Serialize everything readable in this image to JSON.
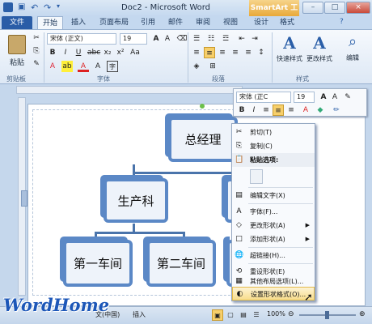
{
  "window": {
    "title": "Doc2 - Microsoft Word",
    "context_tab": "SmartArt 工具",
    "buttons": [
      "–",
      "□",
      "×"
    ]
  },
  "tabs": [
    "文件",
    "开始",
    "插入",
    "页面布局",
    "引用",
    "邮件",
    "审阅",
    "视图",
    "设计",
    "格式"
  ],
  "ribbon": {
    "paste": "粘贴",
    "font_name": "宋体 (正文)",
    "font_size": "19",
    "quick_styles": "快速样式",
    "change_styles": "更改样式",
    "edit": "编辑",
    "groups": {
      "clipboard": "剪贴板",
      "font": "字体",
      "paragraph": "段落",
      "styles": "样式"
    },
    "a_big": "A"
  },
  "mini_toolbar": {
    "font_name": "宋体 (正C",
    "font_size": "19"
  },
  "diagram": {
    "top": "总经理",
    "mid": "生产科",
    "b1": "第一车间",
    "b2": "第二车间"
  },
  "context_menu": [
    {
      "label": "剪切(T)",
      "icon": "scissors-icon"
    },
    {
      "label": "复制(C)",
      "icon": "copy-icon"
    },
    {
      "label": "粘贴选项:",
      "icon": "paste-icon"
    },
    {
      "label": "编辑文字(X)",
      "icon": "edit-text-icon"
    },
    {
      "label": "字体(F)...",
      "icon": "font-icon"
    },
    {
      "label": "更改形状(A)",
      "icon": "change-shape-icon",
      "submenu": true
    },
    {
      "label": "添加形状(A)",
      "icon": "add-shape-icon",
      "submenu": true
    },
    {
      "label": "超链接(H)...",
      "icon": "hyperlink-icon"
    },
    {
      "label": "重设形状(E)",
      "icon": "reset-shape-icon"
    },
    {
      "label": "其他布局选项(L)...",
      "icon": "layout-options-icon"
    },
    {
      "label": "设置形状格式(O)...",
      "icon": "format-shape-icon"
    }
  ],
  "status": {
    "language": "文(中国)",
    "insert": "插入",
    "zoom": "100%"
  },
  "logo": "WordHome"
}
